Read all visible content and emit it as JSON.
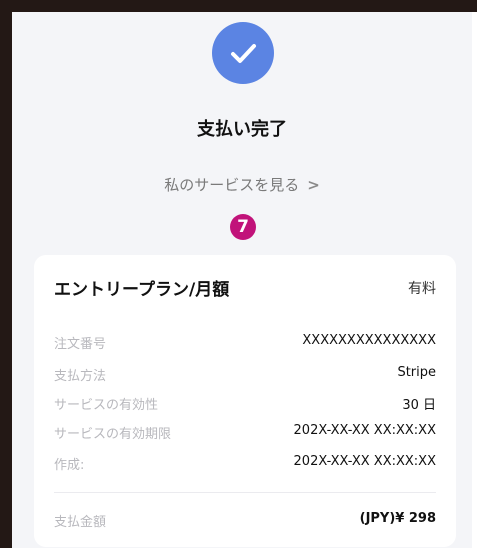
{
  "title": "支払い完了",
  "services_link": {
    "label": "私のサービスを見る",
    "chevron": ">"
  },
  "step_badge": "7",
  "card": {
    "plan_name": "エントリープラン/月額",
    "plan_type": "有料",
    "rows": [
      {
        "label": "注文番号",
        "value": "XXXXXXXXXXXXXXX"
      },
      {
        "label": "支払方法",
        "value": "Stripe"
      },
      {
        "label": "サービスの有効性",
        "value": "30 日"
      },
      {
        "label": "サービスの有効期限",
        "value": "202X-XX-XX XX:XX:XX"
      },
      {
        "label": "作成:",
        "value": "202X-XX-XX XX:XX:XX"
      }
    ],
    "total": {
      "label": "支払金額",
      "value": "(JPY)¥ 298"
    }
  },
  "icons": {
    "status": "check-icon",
    "link": "chevron-right-icon"
  },
  "colors": {
    "accent": "#5b84e3",
    "badge": "#c1137a",
    "background": "#f4f5f8",
    "card": "#ffffff"
  }
}
